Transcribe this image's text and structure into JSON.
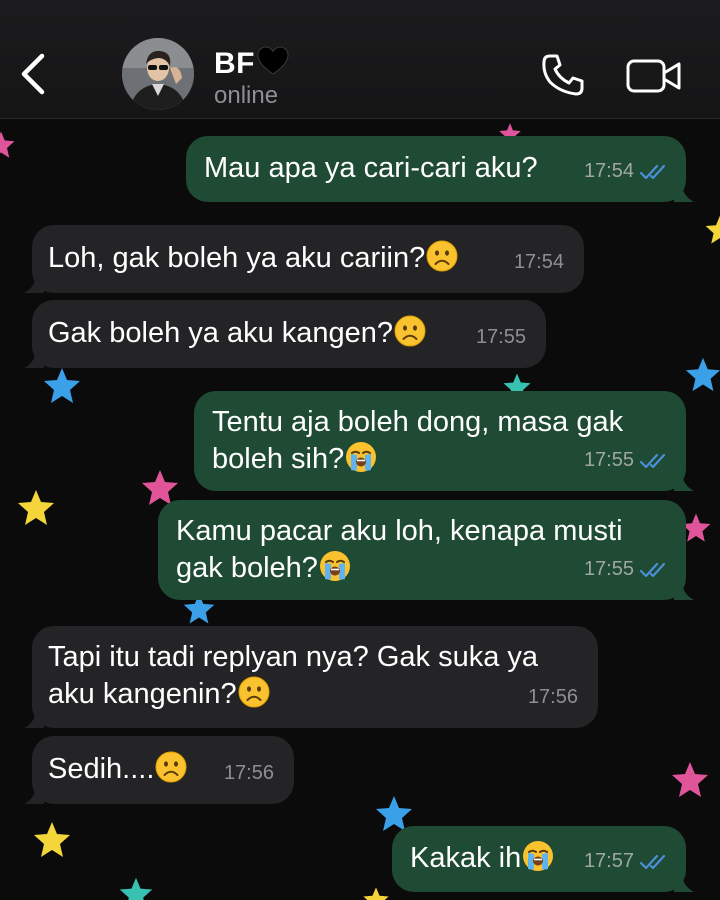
{
  "header": {
    "contact_name": "BF",
    "contact_emoji": "black-heart",
    "status": "online",
    "back_icon": "chevron-left-icon",
    "call_icon": "phone-icon",
    "video_icon": "video-camera-icon"
  },
  "colors": {
    "outgoing_bubble": "#1f4a33",
    "incoming_bubble": "#242426",
    "read_tick": "#4a90d9",
    "background": "#0b0b0c"
  },
  "messages": [
    {
      "direction": "out",
      "text": "Mau apa ya cari-cari aku?",
      "emoji": "",
      "time": "17:54",
      "read": true
    },
    {
      "direction": "in",
      "text": "Loh, gak boleh ya aku cariin?",
      "emoji": "frowning-face",
      "time": "17:54"
    },
    {
      "direction": "in",
      "text": "Gak boleh ya aku kangen?",
      "emoji": "frowning-face",
      "time": "17:55"
    },
    {
      "direction": "out",
      "line1": "Tentu aja boleh dong, masa gak",
      "line2": "boleh sih?",
      "emoji": "loudly-crying-face",
      "time": "17:55",
      "read": true
    },
    {
      "direction": "out",
      "line1": "Kamu pacar aku loh, kenapa musti",
      "line2": "gak boleh?",
      "emoji": "loudly-crying-face",
      "time": "17:55",
      "read": true
    },
    {
      "direction": "in",
      "line1": "Tapi itu tadi replyan nya? Gak suka ya",
      "line2": "aku kangenin?",
      "emoji": "frowning-face",
      "time": "17:56"
    },
    {
      "direction": "in",
      "text": "Sedih....",
      "emoji": "frowning-face",
      "time": "17:56"
    },
    {
      "direction": "out",
      "text": "Kakak ih",
      "emoji": "loudly-crying-face",
      "time": "17:57",
      "read": true
    }
  ]
}
